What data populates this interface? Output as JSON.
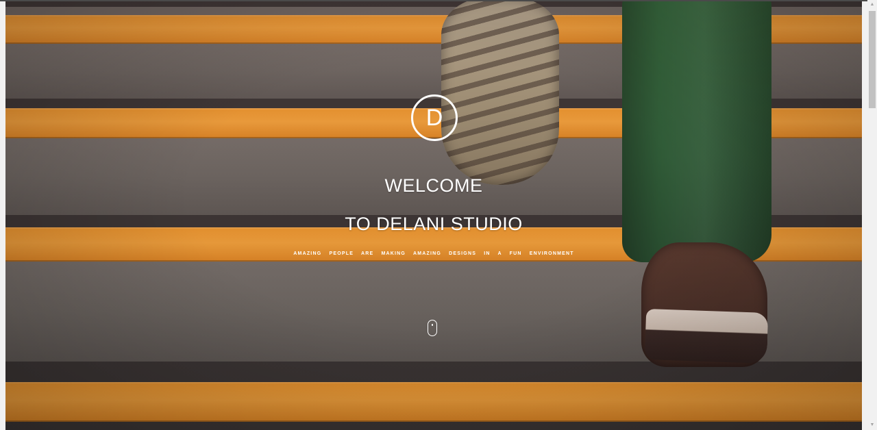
{
  "hero": {
    "logo_letter": "D",
    "title_line1": "WELCOME",
    "title_line2": "TO DELANI STUDIO",
    "tagline": "AMAZING PEOPLE ARE MAKING AMAZING DESIGNS IN A FUN ENVIRONMENT",
    "scroll_indicator_icon": "mouse-icon"
  },
  "colors": {
    "overlay_text": "#ffffff",
    "stair_stripe": "#f29a2c",
    "stair_riser": "#6f6a63"
  },
  "scrollbar": {
    "up_arrow": "▲",
    "down_arrow": "▼"
  }
}
